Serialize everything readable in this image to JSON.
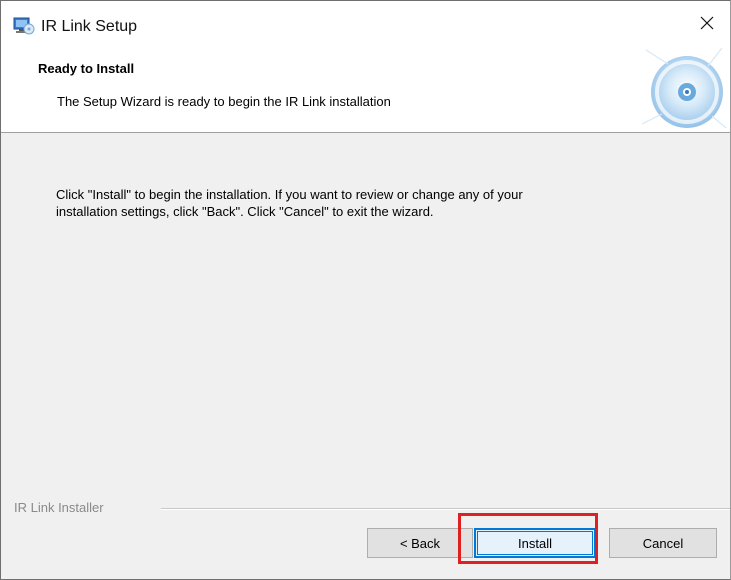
{
  "window": {
    "title": "IR Link Setup",
    "app_icon": "installer-computer-icon",
    "close_icon": "close-icon"
  },
  "banner": {
    "title": "Ready to Install",
    "subtitle": "The Setup Wizard is ready to begin the IR Link installation",
    "graphic": "cd-disc-icon"
  },
  "body": {
    "text": "Click \"Install\" to begin the installation.  If you want to review or change any of your\ninstallation settings, click \"Back\".  Click \"Cancel\" to exit the wizard."
  },
  "footer": {
    "label": "IR Link Installer"
  },
  "buttons": {
    "back_label": "< Back",
    "install_label": "Install",
    "cancel_label": "Cancel"
  },
  "colors": {
    "focus_border": "#0078d7",
    "highlight": "#e02020",
    "dialog_bg": "#f0f0f0"
  }
}
